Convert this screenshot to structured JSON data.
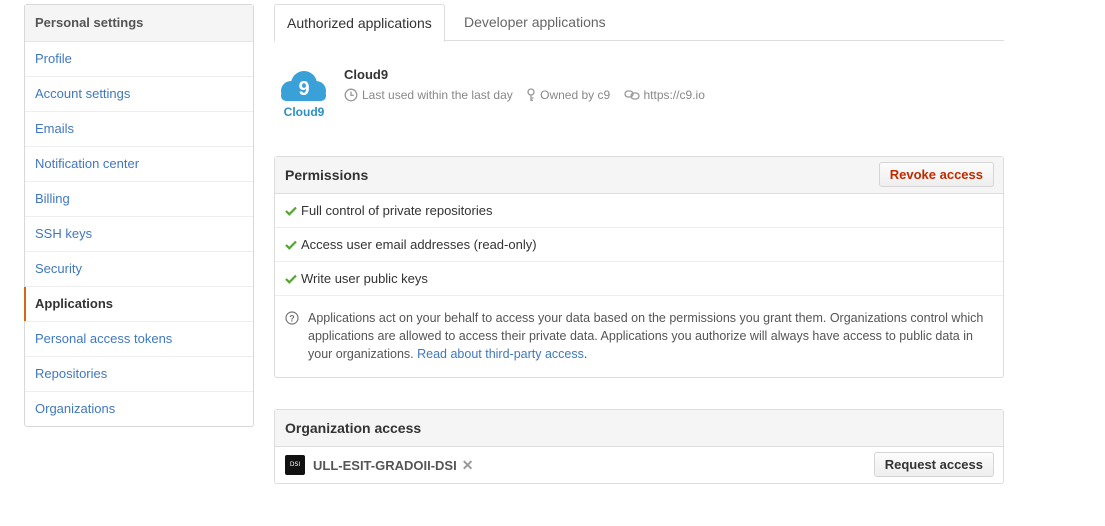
{
  "sidebar": {
    "heading": "Personal settings",
    "items": [
      {
        "label": "Profile"
      },
      {
        "label": "Account settings"
      },
      {
        "label": "Emails"
      },
      {
        "label": "Notification center"
      },
      {
        "label": "Billing"
      },
      {
        "label": "SSH keys"
      },
      {
        "label": "Security"
      },
      {
        "label": "Applications",
        "selected": true
      },
      {
        "label": "Personal access tokens"
      },
      {
        "label": "Repositories"
      },
      {
        "label": "Organizations"
      }
    ]
  },
  "tabs": {
    "authorized": "Authorized applications",
    "developer": "Developer applications",
    "active": "authorized"
  },
  "app": {
    "name": "Cloud9",
    "logo_text": "Cloud9",
    "logo_digit": "9",
    "last_used": "Last used within the last day",
    "owner": "Owned by c9",
    "url": "https://c9.io",
    "logo_color": "#3aa0d8"
  },
  "permissions": {
    "title": "Permissions",
    "revoke_label": "Revoke access",
    "items": [
      "Full control of private repositories",
      "Access user email addresses (read-only)",
      "Write user public keys"
    ],
    "note": "Applications act on your behalf to access your data based on the permissions you grant them. Organizations control which applications are allowed to access their private data. Applications you authorize will always have access to public data in your organizations.",
    "note_link": "Read about third-party access",
    "note_end": ".",
    "check_color": "#55a532"
  },
  "org_access": {
    "title": "Organization access",
    "org_name": "ULL-ESIT-GRADOII-DSI",
    "org_avatar_text": "DSI",
    "request_label": "Request access"
  }
}
